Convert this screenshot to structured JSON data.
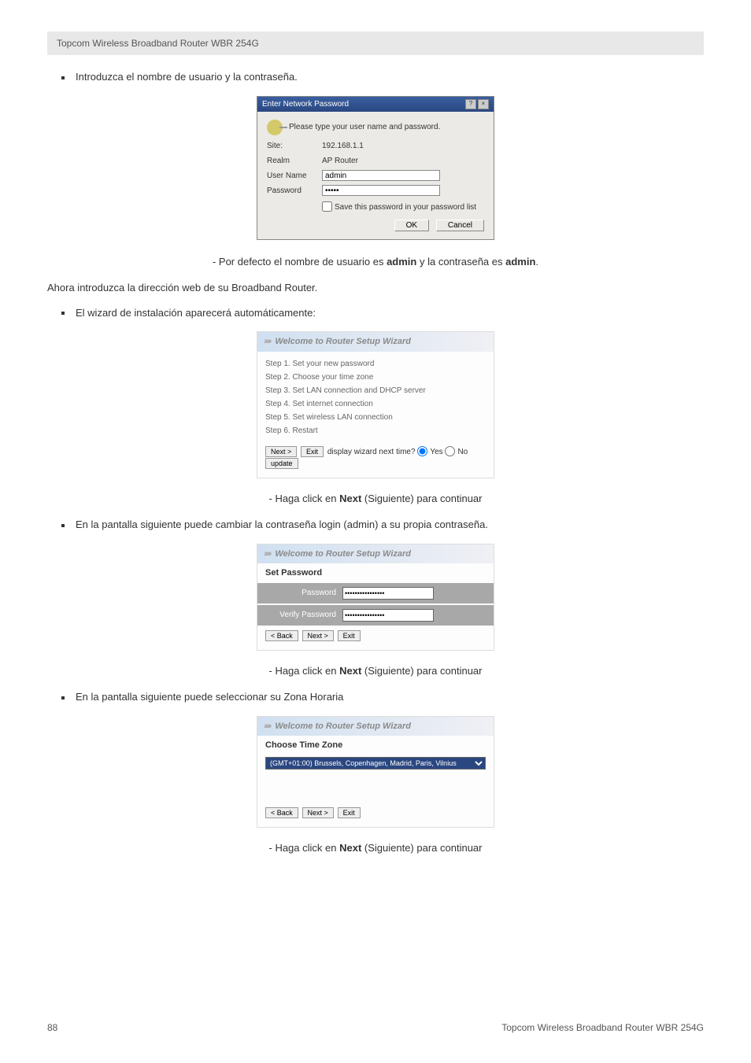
{
  "header": {
    "product": "Topcom Wireless Broadband Router WBR 254G"
  },
  "bullets": {
    "b1": "Introduzca el nombre de usuario y la contraseña.",
    "b2": "El wizard de instalación aparecerá automáticamente:",
    "b3": "En la pantalla siguiente puede cambiar la contraseña login (admin) a su propia contraseña.",
    "b4": "En la pantalla siguiente puede seleccionar su Zona Horaria"
  },
  "dialog": {
    "title": "Enter Network Password",
    "prompt": "Please type your user name and password.",
    "site_label": "Site:",
    "site_value": "192.168.1.1",
    "realm_label": "Realm",
    "realm_value": "AP Router",
    "user_label": "User Name",
    "user_value": "admin",
    "pass_label": "Password",
    "pass_value": "*****",
    "save_label": "Save this password in your password list",
    "ok": "OK",
    "cancel": "Cancel"
  },
  "notes": {
    "default_creds_pre": "- Por defecto el nombre de usuario es ",
    "default_creds_mid": " y la contraseña es ",
    "admin": "admin",
    "period": ".",
    "enter_url": "Ahora introduzca la dirección web de su Broadband Router.",
    "click_next_pre": "- Haga click en ",
    "next_word": "Next",
    "click_next_post": " (Siguiente) para continuar"
  },
  "wizard1": {
    "banner": "Welcome to Router Setup Wizard",
    "s1": "Step 1. Set your new password",
    "s2": "Step 2. Choose your time zone",
    "s3": "Step 3. Set LAN connection and DHCP server",
    "s4": "Step 4. Set internet connection",
    "s5": "Step 5. Set wireless LAN connection",
    "s6": "Step 6. Restart",
    "next": "Next >",
    "exit": "Exit",
    "display_q": "display wizard next time?",
    "yes": "Yes",
    "no": "No",
    "update": "update"
  },
  "wizard2": {
    "banner": "Welcome to Router Setup Wizard",
    "title": "Set Password",
    "pass_label": "Password",
    "pass_value": "****************",
    "verify_label": "Verify Password",
    "verify_value": "****************",
    "back": "< Back",
    "next": "Next >",
    "exit": "Exit"
  },
  "wizard3": {
    "banner": "Welcome to Router Setup Wizard",
    "title": "Choose Time Zone",
    "option": "(GMT+01:00) Brussels, Copenhagen, Madrid, Paris, Vilnius",
    "back": "< Back",
    "next": "Next >",
    "exit": "Exit"
  },
  "footer": {
    "page": "88",
    "product": "Topcom Wireless Broadband Router WBR 254G"
  }
}
